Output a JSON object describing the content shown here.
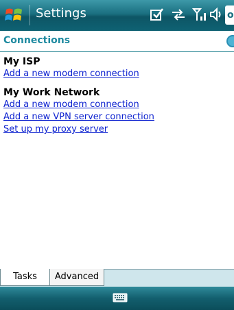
{
  "titlebar": {
    "title": "Settings",
    "ok_label": "o"
  },
  "header": {
    "title": "Connections"
  },
  "sections": [
    {
      "title": "My ISP",
      "links": [
        "Add a new modem connection"
      ]
    },
    {
      "title": "My Work Network",
      "links": [
        "Add a new modem connection",
        "Add a new VPN server connection",
        "Set up my proxy server"
      ]
    }
  ],
  "tabs": [
    "Tasks",
    "Advanced"
  ],
  "colors": {
    "header_text": "#1e8aa0",
    "link": "#0a1fcf",
    "titlebar": "#1a6f80"
  },
  "icons": {
    "start": "windows-flag-icon",
    "status": [
      "notes-check-icon",
      "connectivity-arrows-icon",
      "signal-icon",
      "volume-icon"
    ],
    "help": "help-icon",
    "keyboard": "keyboard-icon"
  }
}
